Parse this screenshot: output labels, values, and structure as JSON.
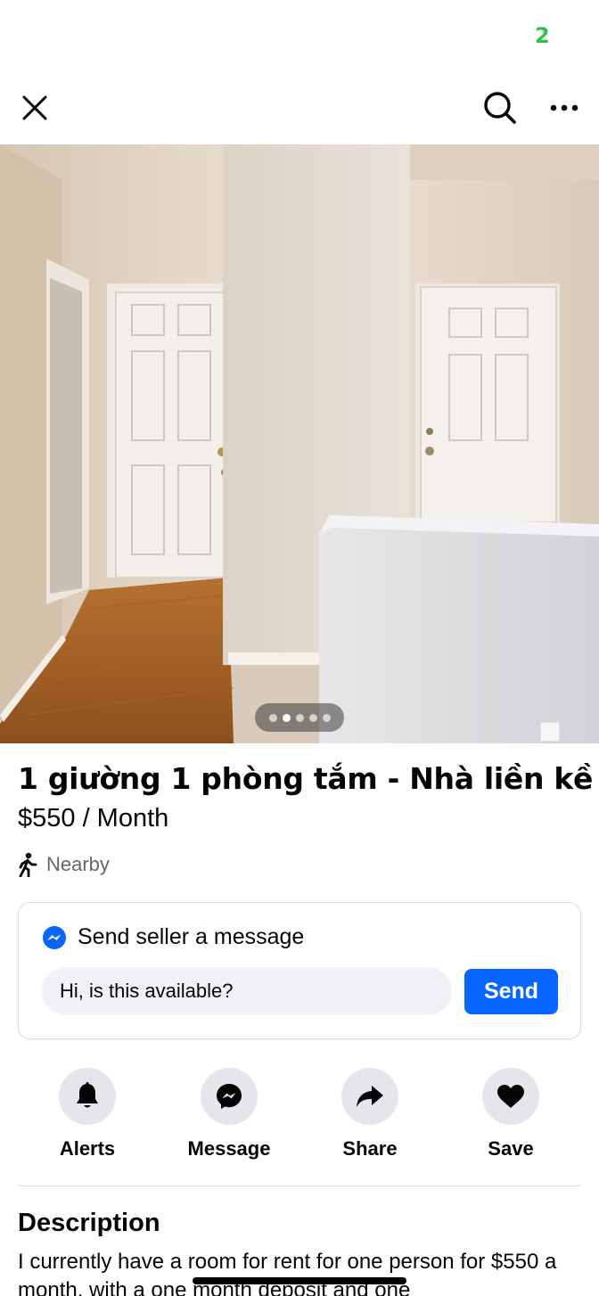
{
  "status_bar": {
    "indicator": "2"
  },
  "top_bar": {
    "close_icon": "close-icon",
    "search_icon": "search-icon",
    "more_icon": "more-horizontal-icon"
  },
  "photo": {
    "carousel_pages": 5,
    "active_page": 2
  },
  "listing": {
    "title": "1 giường 1 phòng tắm - Nhà liền kề",
    "price": "$550 / Month",
    "location": "Nearby"
  },
  "message_card": {
    "title": "Send seller a message",
    "input_value": "Hi, is this available?",
    "send_label": "Send"
  },
  "actions": [
    {
      "label": "Alerts",
      "icon": "bell-icon"
    },
    {
      "label": "Message",
      "icon": "messenger-icon"
    },
    {
      "label": "Share",
      "icon": "share-icon"
    },
    {
      "label": "Save",
      "icon": "heart-icon"
    }
  ],
  "description": {
    "heading": "Description",
    "text": "I currently have a room for rent for one person for $550 a month, with a one month deposit and one"
  },
  "colors": {
    "accent": "#0866ff",
    "text": "#050505",
    "secondary_text": "#65676b"
  }
}
